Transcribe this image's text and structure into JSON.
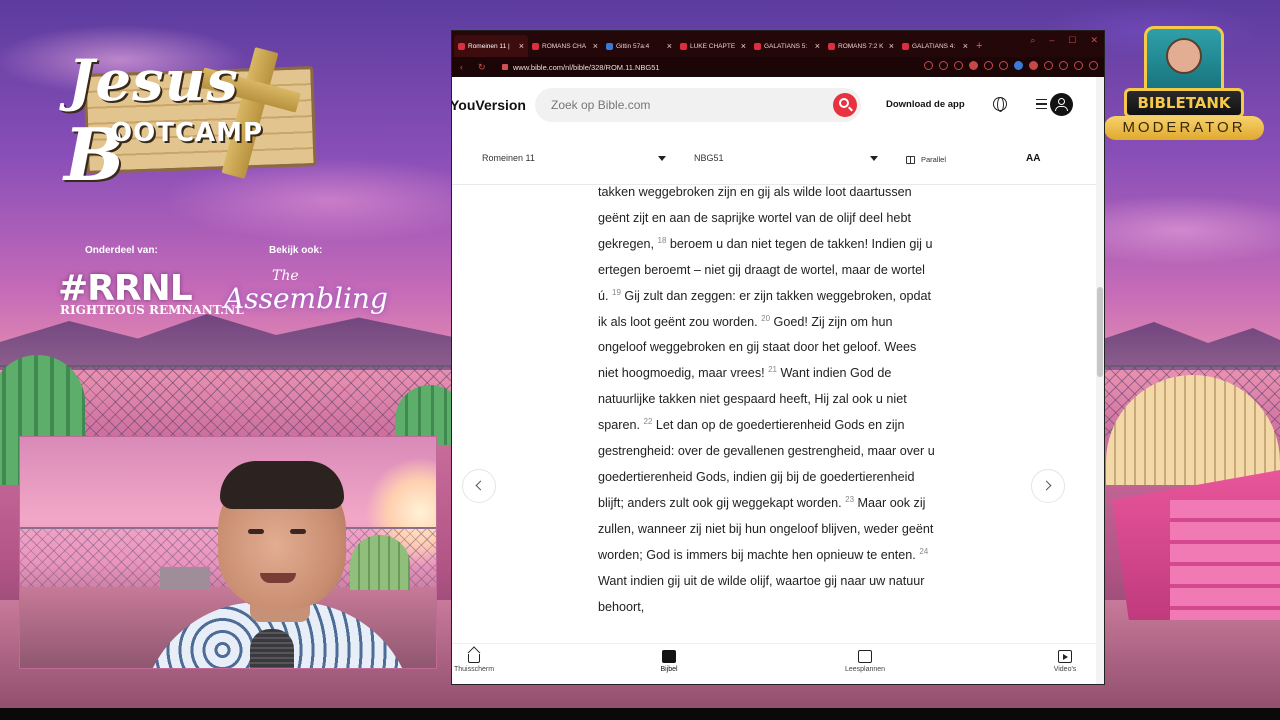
{
  "overlay": {
    "logo_script": "Jesus",
    "logo_bootcamp_initial": "B",
    "logo_bootcamp_rest": "OOTCAMP",
    "part_of_label": "Onderdeel van:",
    "see_also_label": "Bekijk ook:",
    "rrnl_logo": "#RRNL",
    "rrnl_subtitle": "RIGHTEOUS REMNANT.NL",
    "assembling_the": "The",
    "assembling_logo": "Assembling",
    "moderator_title": "BIBLETANK",
    "moderator_banner": "MODERATOR"
  },
  "browser": {
    "tabs": [
      {
        "label": "Romeinen 11 |",
        "active": true
      },
      {
        "label": "ROMANS CHA",
        "active": false
      },
      {
        "label": "Gittin 57a:4",
        "active": false
      },
      {
        "label": "LUKE CHAPTE",
        "active": false
      },
      {
        "label": "GALATIANS 5:",
        "active": false
      },
      {
        "label": "ROMANS 7:2 K",
        "active": false
      },
      {
        "label": "GALATIANS 4:",
        "active": false
      }
    ],
    "new_tab": "+",
    "url": "www.bible.com/nl/bible/328/ROM.11.NBG51"
  },
  "site": {
    "brand": "YouVersion",
    "search_placeholder": "Zoek op Bible.com",
    "download_label": "Download de app",
    "book_select": "Romeinen 11",
    "version_select": "NBG51",
    "parallel_label": "Parallel",
    "font_size_label": "AA"
  },
  "passage": {
    "segments": [
      {
        "type": "text",
        "text": "takken weggebroken zijn en gij als wilde loot daartussen geënt zijt en aan de saprijke wortel van de olijf deel hebt gekregen, "
      },
      {
        "type": "verse",
        "text": "18"
      },
      {
        "type": "text",
        "text": " beroem u dan niet tegen de takken! Indien gij u ertegen beroemt – niet gij draagt de wortel, maar de wortel ú. "
      },
      {
        "type": "verse",
        "text": "19"
      },
      {
        "type": "text",
        "text": " Gij zult dan zeggen: er zijn takken weggebroken, opdat ik als loot geënt zou worden. "
      },
      {
        "type": "verse",
        "text": "20"
      },
      {
        "type": "text",
        "text": " Goed! Zij zijn om hun ongeloof weggebroken en gij staat door het geloof. Wees niet hoogmoedig, maar vrees! "
      },
      {
        "type": "verse",
        "text": "21"
      },
      {
        "type": "text",
        "text": " Want indien God de natuurlijke takken niet gespaard heeft, Hij zal ook u niet sparen. "
      },
      {
        "type": "verse",
        "text": "22"
      },
      {
        "type": "text",
        "text": " Let dan op de goedertierenheid Gods en zijn gestrengheid: over de gevallenen gestrengheid, maar over u goedertierenheid Gods, indien gij bij de goedertierenheid blijft; anders zult ook gij weggekapt worden. "
      },
      {
        "type": "verse",
        "text": "23"
      },
      {
        "type": "text",
        "text": " Maar ook zij zullen, wanneer zij niet bij hun ongeloof blijven, weder geënt worden; God is immers bij machte hen opnieuw te enten. "
      },
      {
        "type": "verse",
        "text": "24"
      },
      {
        "type": "text",
        "text": " Want indien gij uit de wilde olijf, waartoe gij naar uw natuur behoort,"
      }
    ]
  },
  "bottom_nav": [
    {
      "label": "Thuisscherm",
      "icon": "home-icon"
    },
    {
      "label": "Bijbel",
      "icon": "bible-icon",
      "active": true
    },
    {
      "label": "Leesplannen",
      "icon": "plans-icon"
    },
    {
      "label": "Video's",
      "icon": "videos-icon"
    }
  ],
  "colors": {
    "accent_red": "#e6333f",
    "tabbar_bg": "#240708"
  }
}
